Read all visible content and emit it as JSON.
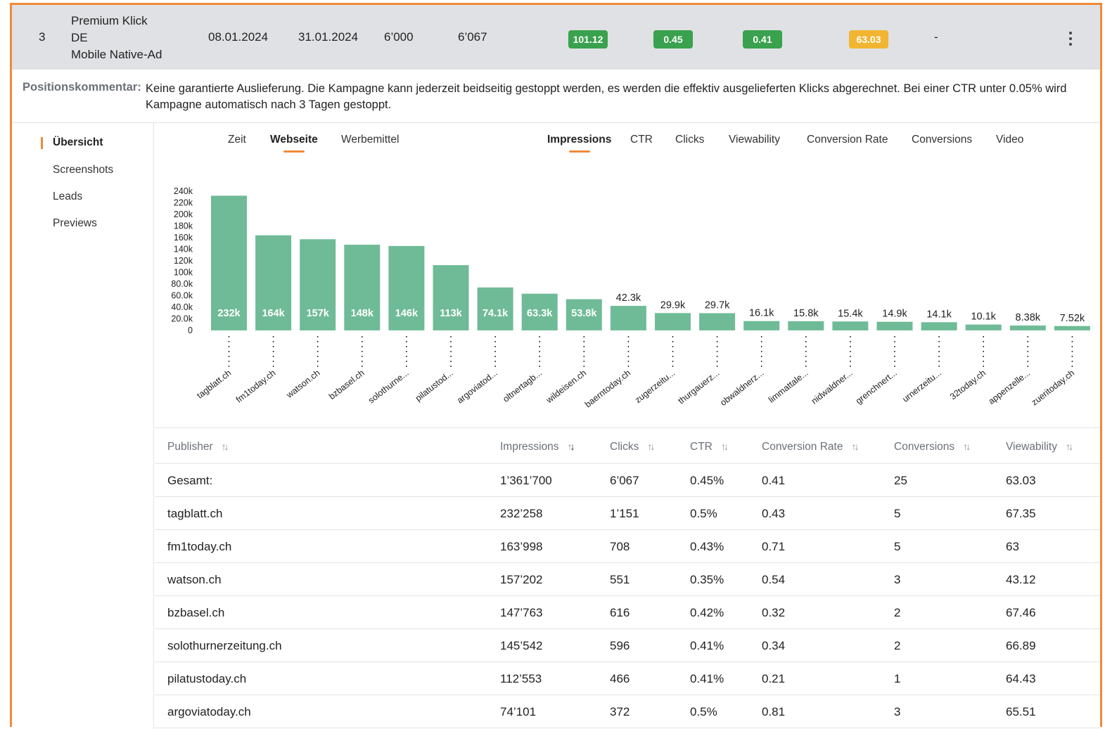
{
  "position_row": {
    "number": "3",
    "name_lines": [
      "Premium Klick",
      "DE",
      "Mobile Native-Ad"
    ],
    "start_date": "08.01.2024",
    "end_date": "31.01.2024",
    "booked": "6’000",
    "delivered": "6’067",
    "badges": [
      {
        "value": "101.12",
        "color": "#3aa14e"
      },
      {
        "value": "0.45",
        "color": "#3aa14e"
      },
      {
        "value": "0.41",
        "color": "#3aa14e"
      },
      {
        "value": "63.03",
        "color": "#f2b531"
      }
    ],
    "dash": "-"
  },
  "comment": {
    "label": "Positionskommentar:",
    "text": "Keine garantierte Auslieferung. Die Kampagne kann jederzeit beidseitig gestoppt werden, es werden die effektiv ausgelieferten Klicks abgerechnet. Bei einer CTR unter 0.05% wird Kampagne automatisch nach 3 Tagen gestoppt."
  },
  "sidebar": {
    "items": [
      {
        "label": "Übersicht",
        "active": true
      },
      {
        "label": "Screenshots",
        "active": false
      },
      {
        "label": "Leads",
        "active": false
      },
      {
        "label": "Previews",
        "active": false
      }
    ]
  },
  "dimension_tabs": [
    {
      "label": "Zeit",
      "active": false
    },
    {
      "label": "Webseite",
      "active": true
    },
    {
      "label": "Werbemittel",
      "active": false
    }
  ],
  "metric_tabs": [
    {
      "label": "Impressions",
      "active": true
    },
    {
      "label": "CTR",
      "active": false
    },
    {
      "label": "Clicks",
      "active": false
    },
    {
      "label": "Viewability",
      "active": false
    },
    {
      "label": "Conversion Rate",
      "active": false
    },
    {
      "label": "Conversions",
      "active": false
    },
    {
      "label": "Video",
      "active": false
    }
  ],
  "chart_data": {
    "type": "bar",
    "categories": [
      "tagblatt.ch",
      "fm1today.ch",
      "watson.ch",
      "bzbasel.ch",
      "solothurne...",
      "pilatustod...",
      "argoviatod...",
      "oltnertagb...",
      "wildeisen.ch",
      "baerntoday.ch",
      "zugerzeitu...",
      "thurgauerz...",
      "obwaldnerz...",
      "limmattale...",
      "nidwaldner...",
      "grenchnert...",
      "urnerzeitu...",
      "32today.ch",
      "appenzelle...",
      "zueritoday.ch"
    ],
    "values": [
      232258,
      163998,
      157202,
      147763,
      145542,
      112553,
      74101,
      63300,
      53800,
      42300,
      29900,
      29700,
      16100,
      15800,
      15400,
      14900,
      14100,
      10100,
      8380,
      7520
    ],
    "value_labels": [
      "232k",
      "164k",
      "157k",
      "148k",
      "146k",
      "113k",
      "74.1k",
      "63.3k",
      "53.8k",
      "42.3k",
      "29.9k",
      "29.7k",
      "16.1k",
      "15.8k",
      "15.4k",
      "14.9k",
      "14.1k",
      "10.1k",
      "8.38k",
      "7.52k"
    ],
    "y_ticks": [
      "0",
      "20.0k",
      "40.0k",
      "60.0k",
      "80.0k",
      "100k",
      "120k",
      "140k",
      "160k",
      "180k",
      "200k",
      "220k",
      "240k"
    ],
    "ylim": [
      0,
      240000
    ],
    "bar_color": "#6fbb97",
    "grid": false
  },
  "table": {
    "headers": [
      "Publisher",
      "Impressions",
      "Clicks",
      "CTR",
      "Conversion Rate",
      "Conversions",
      "Viewability"
    ],
    "sorted_column": 1,
    "rows": [
      [
        "Gesamt:",
        "1’361’700",
        "6’067",
        "0.45%",
        "0.41",
        "25",
        "63.03"
      ],
      [
        "tagblatt.ch",
        "232’258",
        "1’151",
        "0.5%",
        "0.43",
        "5",
        "67.35"
      ],
      [
        "fm1today.ch",
        "163’998",
        "708",
        "0.43%",
        "0.71",
        "5",
        "63"
      ],
      [
        "watson.ch",
        "157’202",
        "551",
        "0.35%",
        "0.54",
        "3",
        "43.12"
      ],
      [
        "bzbasel.ch",
        "147’763",
        "616",
        "0.42%",
        "0.32",
        "2",
        "67.46"
      ],
      [
        "solothurnerzeitung.ch",
        "145’542",
        "596",
        "0.41%",
        "0.34",
        "2",
        "66.89"
      ],
      [
        "pilatustoday.ch",
        "112’553",
        "466",
        "0.41%",
        "0.21",
        "1",
        "64.43"
      ],
      [
        "argoviatoday.ch",
        "74’101",
        "372",
        "0.5%",
        "0.81",
        "3",
        "65.51"
      ]
    ]
  }
}
